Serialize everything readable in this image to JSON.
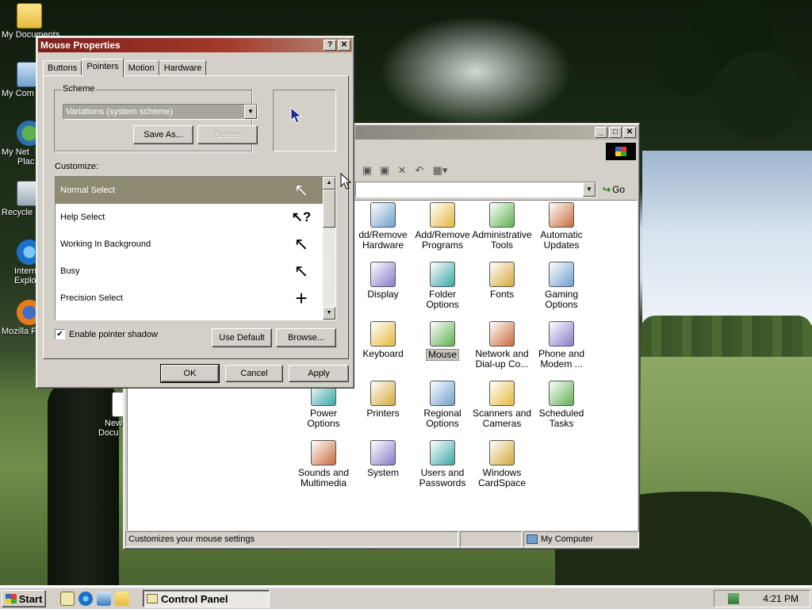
{
  "desktop": {
    "icons": [
      {
        "label": "My Documents",
        "icon": "folder-icon"
      },
      {
        "label": "My Com",
        "icon": "computer-icon"
      },
      {
        "label": "My Net",
        "label2": "Plac",
        "icon": "network-icon"
      },
      {
        "label": "Recycle",
        "icon": "recycle-bin-icon"
      },
      {
        "label": "Intern",
        "label2": "Explo",
        "icon": "internet-explorer-icon"
      },
      {
        "label": "Mozilla F",
        "icon": "firefox-icon"
      },
      {
        "label": "New",
        "label2": "Docu",
        "icon": "document-icon"
      }
    ]
  },
  "control_panel": {
    "address_go": "Go",
    "status_text": "Customizes your mouse settings",
    "status_zone": "My Computer",
    "items": [
      {
        "line1": "dd/Remove",
        "line2": "Hardware",
        "icon": "add-hardware-icon"
      },
      {
        "line1": "Add/Remove",
        "line2": "Programs",
        "icon": "add-remove-programs-icon"
      },
      {
        "line1": "Administrative",
        "line2": "Tools",
        "icon": "administrative-tools-icon"
      },
      {
        "line1": "Automatic",
        "line2": "Updates",
        "icon": "automatic-updates-icon"
      },
      {
        "line1": "Display",
        "line2": "",
        "icon": "display-icon"
      },
      {
        "line1": "Folder Options",
        "line2": "",
        "icon": "folder-options-icon"
      },
      {
        "line1": "Fonts",
        "line2": "",
        "icon": "fonts-icon"
      },
      {
        "line1": "Gaming",
        "line2": "Options",
        "icon": "gaming-options-icon"
      },
      {
        "line1": "Keyboard",
        "line2": "",
        "icon": "keyboard-icon"
      },
      {
        "line1": "Mouse",
        "line2": "",
        "icon": "mouse-icon"
      },
      {
        "line1": "Network and",
        "line2": "Dial-up Co...",
        "icon": "network-dialup-icon"
      },
      {
        "line1": "Phone and",
        "line2": "Modem ...",
        "icon": "phone-modem-icon"
      },
      {
        "line1": "Power Options",
        "line2": "",
        "icon": "power-options-icon"
      },
      {
        "line1": "Printers",
        "line2": "",
        "icon": "printers-icon"
      },
      {
        "line1": "Regional",
        "line2": "Options",
        "icon": "regional-options-icon"
      },
      {
        "line1": "Scanners and",
        "line2": "Cameras",
        "icon": "scanners-cameras-icon"
      },
      {
        "line1": "Scheduled",
        "line2": "Tasks",
        "icon": "scheduled-tasks-icon"
      },
      {
        "line1": "Sounds and",
        "line2": "Multimedia",
        "icon": "sounds-multimedia-icon"
      },
      {
        "line1": "System",
        "line2": "",
        "icon": "system-icon"
      },
      {
        "line1": "Users and",
        "line2": "Passwords",
        "icon": "users-passwords-icon"
      },
      {
        "line1": "Windows",
        "line2": "CardSpace",
        "icon": "cardspace-icon"
      }
    ]
  },
  "mouse_properties": {
    "title": "Mouse Properties",
    "help_btn": "?",
    "close_btn": "✕",
    "tabs": [
      "Buttons",
      "Pointers",
      "Motion",
      "Hardware"
    ],
    "active_tab": "Pointers",
    "scheme_label": "Scheme",
    "scheme_value": "Variations (system scheme)",
    "save_as": "Save As...",
    "delete": "Delete",
    "customize_label": "Customize:",
    "pointers": [
      {
        "name": "Normal Select",
        "glyph": "↖"
      },
      {
        "name": "Help Select",
        "glyph": "↖?"
      },
      {
        "name": "Working In Background",
        "glyph": "↖"
      },
      {
        "name": "Busy",
        "glyph": "↖"
      },
      {
        "name": "Precision Select",
        "glyph": "+"
      }
    ],
    "shadow_label": "Enable pointer shadow",
    "shadow_checked": "✔",
    "use_default": "Use Default",
    "browse": "Browse...",
    "ok": "OK",
    "cancel": "Cancel",
    "apply": "Apply"
  },
  "taskbar": {
    "start": "Start",
    "task": "Control Panel",
    "clock": "4:21 PM"
  },
  "colors": {
    "title_active": "#7e1f1a",
    "face": "#d4d0c8",
    "list_selected": "#8e8a72"
  }
}
